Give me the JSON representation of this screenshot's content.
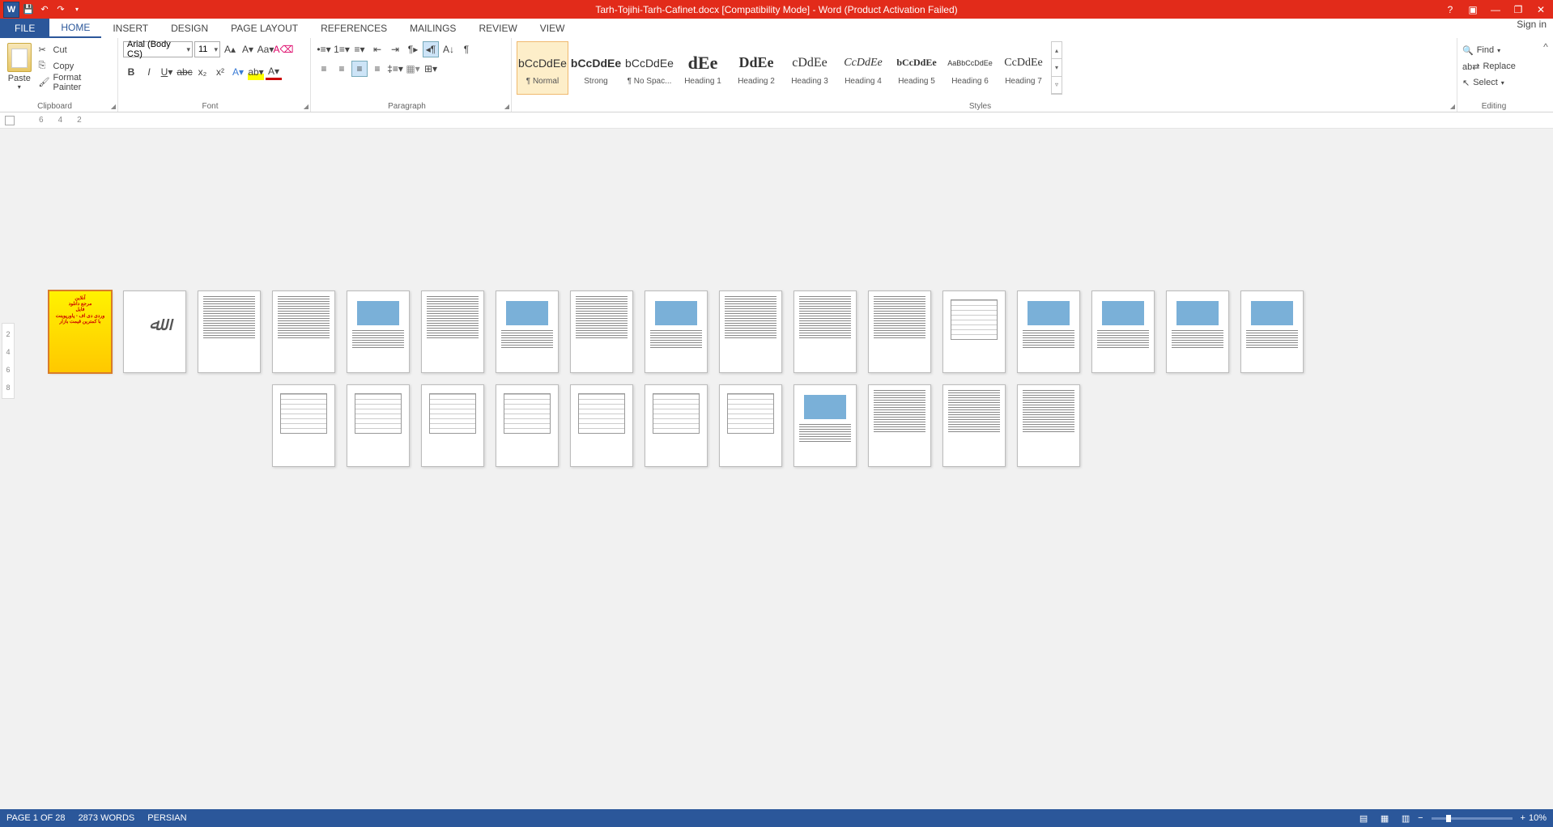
{
  "titlebar": {
    "title": "Tarh-Tojihi-Tarh-Cafinet.docx [Compatibility Mode] - Word (Product Activation Failed)"
  },
  "tabs": {
    "file": "FILE",
    "list": [
      "HOME",
      "INSERT",
      "DESIGN",
      "PAGE LAYOUT",
      "REFERENCES",
      "MAILINGS",
      "REVIEW",
      "VIEW"
    ],
    "signin": "Sign in"
  },
  "clipboard": {
    "paste": "Paste",
    "cut": "Cut",
    "copy": "Copy",
    "format_painter": "Format Painter",
    "label": "Clipboard"
  },
  "font": {
    "name": "Arial (Body CS)",
    "size": "11",
    "label": "Font"
  },
  "paragraph": {
    "label": "Paragraph"
  },
  "styles": {
    "label": "Styles",
    "items": [
      {
        "preview": "bCcDdEe",
        "name": "¶ Normal",
        "cls": ""
      },
      {
        "preview": "bCcDdEe",
        "name": "Strong",
        "cls": ""
      },
      {
        "preview": "bCcDdEe",
        "name": "¶ No Spac...",
        "cls": ""
      },
      {
        "preview": "dEe",
        "name": "Heading 1",
        "cls": "hp-h1"
      },
      {
        "preview": "DdEe",
        "name": "Heading 2",
        "cls": "hp-h2"
      },
      {
        "preview": "cDdEe",
        "name": "Heading 3",
        "cls": "hp-h3"
      },
      {
        "preview": "CcDdEe",
        "name": "Heading 4",
        "cls": "hp-h4"
      },
      {
        "preview": "bCcDdEe",
        "name": "Heading 5",
        "cls": "hp-h5"
      },
      {
        "preview": "AaBbCcDdEe",
        "name": "Heading 6",
        "cls": "hp-h6"
      },
      {
        "preview": "CcDdEe",
        "name": "Heading 7",
        "cls": "hp-h7"
      }
    ]
  },
  "editing": {
    "find": "Find",
    "replace": "Replace",
    "select": "Select",
    "label": "Editing"
  },
  "ruler": {
    "marks": [
      "6",
      "4",
      "2"
    ]
  },
  "vruler": {
    "marks": [
      "2",
      "4",
      "6",
      "8"
    ]
  },
  "status": {
    "page": "PAGE 1 OF 28",
    "words": "2873 WORDS",
    "lang": "PERSIAN",
    "zoom_minus": "−",
    "zoom_plus": "+",
    "zoom": "10%"
  },
  "pages": {
    "total": 28,
    "row1": 17,
    "row2": 11
  }
}
